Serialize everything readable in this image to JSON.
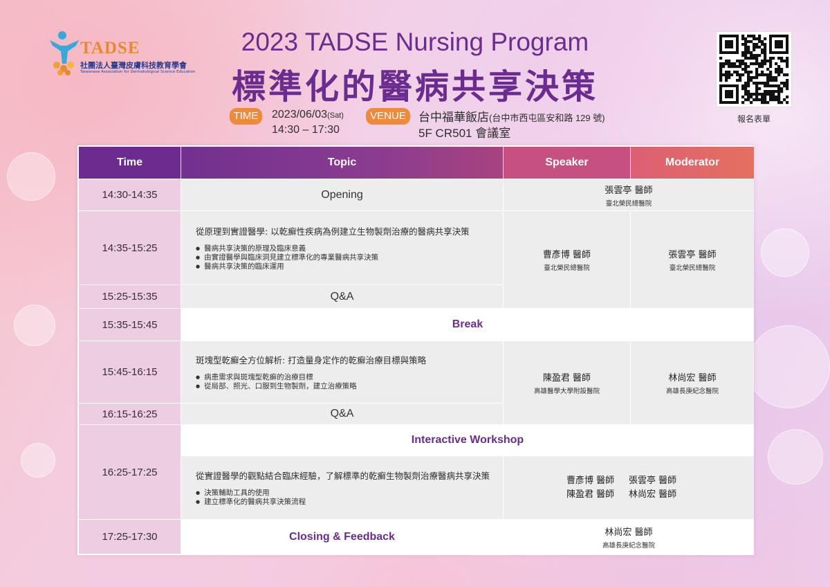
{
  "org": {
    "logo_text": "TADSE",
    "name_zh": "社團法人臺灣皮膚科技教育學會",
    "name_en": "Taiwanese Association for Dermatological Science Education"
  },
  "event": {
    "title_en": "2023 TADSE Nursing Program",
    "title_zh": "標準化的醫病共享決策",
    "time_label": "TIME",
    "date": "2023/06/03",
    "weekday": "(Sat)",
    "hours": "14:30 – 17:30",
    "venue_label": "VENUE",
    "venue_name": "台中福華飯店",
    "venue_address": "(台中市西屯區安和路 129 號)",
    "venue_room": "5F CR501 會議室"
  },
  "qr": {
    "label": "報名表單"
  },
  "table": {
    "headers": {
      "time": "Time",
      "topic": "Topic",
      "speaker": "Speaker",
      "moderator": "Moderator"
    },
    "colors": {
      "header_start": "#6a2a8e",
      "header_end": "#e5705f"
    },
    "r1": {
      "time": "14:30-14:35",
      "topic": "Opening",
      "person": "張雲亭 醫師",
      "hospital": "臺北榮民總醫院"
    },
    "r2": {
      "time": "14:35-15:25",
      "topic": "從原理到實證醫學: 以乾癬性疾病為例建立生物製劑治療的醫病共享決策",
      "bullets": [
        "醫病共享決策的原理及臨床意義",
        "由實證醫學與臨床洞見建立標準化的專業醫病共享決策",
        "醫病共享決策的臨床運用"
      ],
      "speaker": "曹彥博 醫師",
      "speaker_hosp": "臺北榮民總醫院",
      "moderator": "張雲亭 醫師",
      "moderator_hosp": "臺北榮民總醫院"
    },
    "r3": {
      "time": "15:25-15:35",
      "topic": "Q&A"
    },
    "r4": {
      "time": "15:35-15:45",
      "topic": "Break"
    },
    "r5": {
      "time": "15:45-16:15",
      "topic": "斑塊型乾癬全方位解析: 打造量身定作的乾癬治療目標與策略",
      "bullets": [
        "病患需求與斑塊型乾癬的治療目標",
        "從局部、照光、口服到生物製劑，建立治療策略"
      ],
      "speaker": "陳盈君 醫師",
      "speaker_hosp": "高雄醫學大學附設醫院",
      "moderator": "林尚宏 醫師",
      "moderator_hosp": "高雄長庚紀念醫院"
    },
    "r6": {
      "time": "16:15-16:25",
      "topic": "Q&A"
    },
    "r7": {
      "time": "16:25-17:25",
      "title": "Interactive Workshop",
      "topic": "從實證醫學的觀點結合臨床經驗，了解標準的乾癬生物製劑治療醫病共享決策",
      "bullets": [
        "決策輔助工具的使用",
        "建立標準化的醫病共享決策流程"
      ],
      "people": [
        "曹彥博 醫師",
        "張雲亭 醫師",
        "陳盈君 醫師",
        "林尚宏 醫師"
      ]
    },
    "r8": {
      "time": "17:25-17:30",
      "topic": "Closing & Feedback",
      "person": "林尚宏 醫師",
      "hospital": "高雄長庚紀念醫院"
    }
  }
}
